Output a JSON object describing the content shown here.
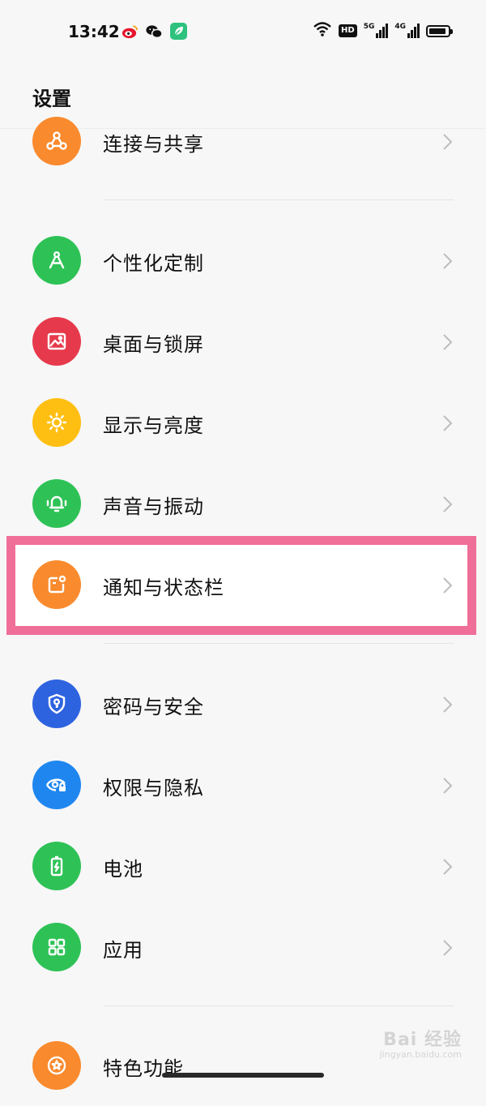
{
  "status_bar": {
    "time": "13:42",
    "hd_label": "HD",
    "net1_label": "5G",
    "net2_label": "4G",
    "battery_level": 0.9
  },
  "header": {
    "title": "设置"
  },
  "items": [
    {
      "label": "连接与共享",
      "color": "#f98a2d",
      "icon": "share-icon"
    },
    {
      "label": "个性化定制",
      "color": "#2ec256",
      "icon": "compass-icon"
    },
    {
      "label": "桌面与锁屏",
      "color": "#e63a4c",
      "icon": "picture-icon"
    },
    {
      "label": "显示与亮度",
      "color": "#ffbf12",
      "icon": "sun-icon"
    },
    {
      "label": "声音与振动",
      "color": "#2ec256",
      "icon": "bell-icon"
    },
    {
      "label": "通知与状态栏",
      "color": "#f98a2d",
      "icon": "notification-icon"
    },
    {
      "label": "密码与安全",
      "color": "#2e63e0",
      "icon": "shield-key-icon"
    },
    {
      "label": "权限与隐私",
      "color": "#1f86f0",
      "icon": "eye-lock-icon"
    },
    {
      "label": "电池",
      "color": "#2ec256",
      "icon": "battery-icon"
    },
    {
      "label": "应用",
      "color": "#2ec256",
      "icon": "apps-grid-icon"
    },
    {
      "label": "特色功能",
      "color": "#f98a2d",
      "icon": "star-icon"
    }
  ],
  "watermark": {
    "logo": "Bai 经验",
    "url": "jingyan.baidu.com"
  }
}
